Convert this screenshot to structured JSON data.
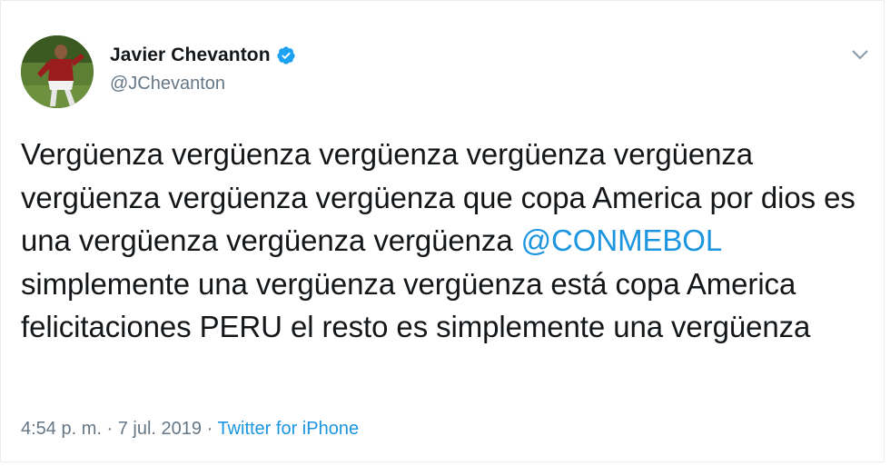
{
  "author": {
    "name": "Javier Chevanton",
    "handle": "@JChevanton",
    "verified": true
  },
  "tweet": {
    "text_before": "Vergüenza vergüenza vergüenza vergüenza vergüenza vergüenza vergüenza vergüenza que copa America por dios es una vergüenza vergüenza vergüenza ",
    "mention": "@CONMEBOL",
    "text_after": " simplemente una vergüenza vergüenza está copa America felicitaciones PERU el resto es simplemente una vergüenza"
  },
  "meta": {
    "timestamp": "4:54 p. m. · 7 jul. 2019",
    "separator": " · ",
    "source": "Twitter for iPhone"
  },
  "colors": {
    "link": "#1b95e0",
    "verified": "#1da1f2",
    "text": "#14171a",
    "secondary": "#657786"
  },
  "icons": {
    "verified": "verified-badge-icon",
    "menu": "chevron-down-icon"
  }
}
